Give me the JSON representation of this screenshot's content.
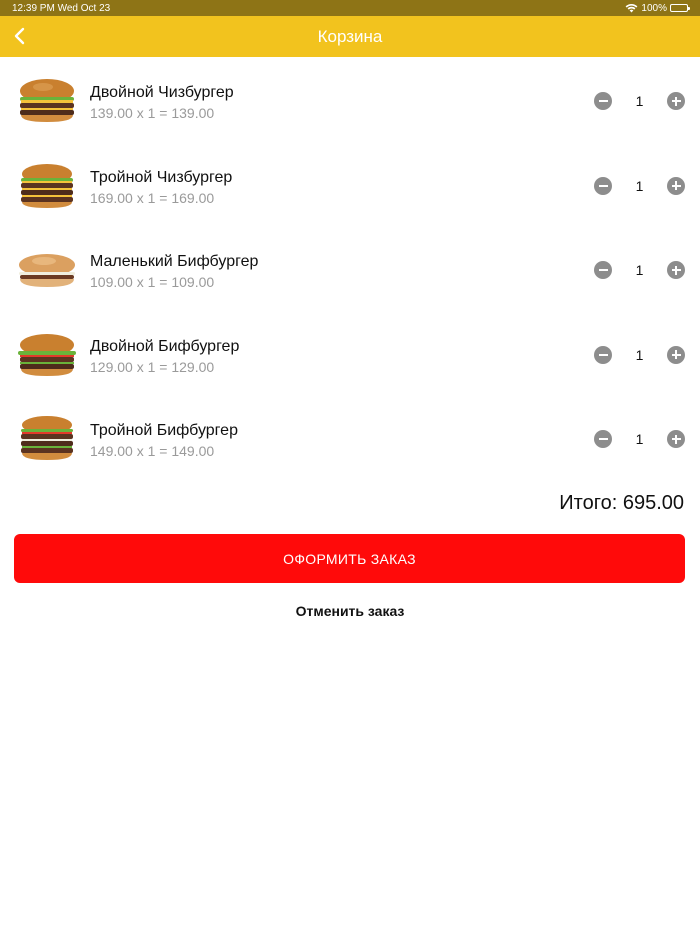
{
  "status": {
    "time_date": "12:39 PM Wed Oct 23",
    "battery_pct": "100%"
  },
  "nav": {
    "title": "Корзина",
    "back_icon": "chevron-left-icon"
  },
  "cart": {
    "items": [
      {
        "name": "Двойной Чизбургер",
        "calc": "139.00 x 1 = 139.00",
        "qty": "1",
        "thumb_icon": "double-cheeseburger-image"
      },
      {
        "name": "Тройной Чизбургер",
        "calc": "169.00 x 1 = 169.00",
        "qty": "1",
        "thumb_icon": "triple-cheeseburger-image"
      },
      {
        "name": "Маленький Бифбургер",
        "calc": "109.00 x 1 = 109.00",
        "qty": "1",
        "thumb_icon": "small-beefburger-image"
      },
      {
        "name": "Двойной Бифбургер",
        "calc": "129.00 x 1 = 129.00",
        "qty": "1",
        "thumb_icon": "double-beefburger-image"
      },
      {
        "name": "Тройной Бифбургер",
        "calc": "149.00 x 1 = 149.00",
        "qty": "1",
        "thumb_icon": "triple-beefburger-image"
      }
    ],
    "total_label": "Итого: 695.00"
  },
  "actions": {
    "checkout_label": "ОФОРМИТЬ ЗАКАЗ",
    "cancel_label": "Отменить заказ"
  },
  "colors": {
    "nav_yellow": "#f2c31e",
    "status_bar": "#8e7416",
    "checkout_red": "#ff0a0a",
    "qty_button_gray": "#8d8d8d"
  }
}
